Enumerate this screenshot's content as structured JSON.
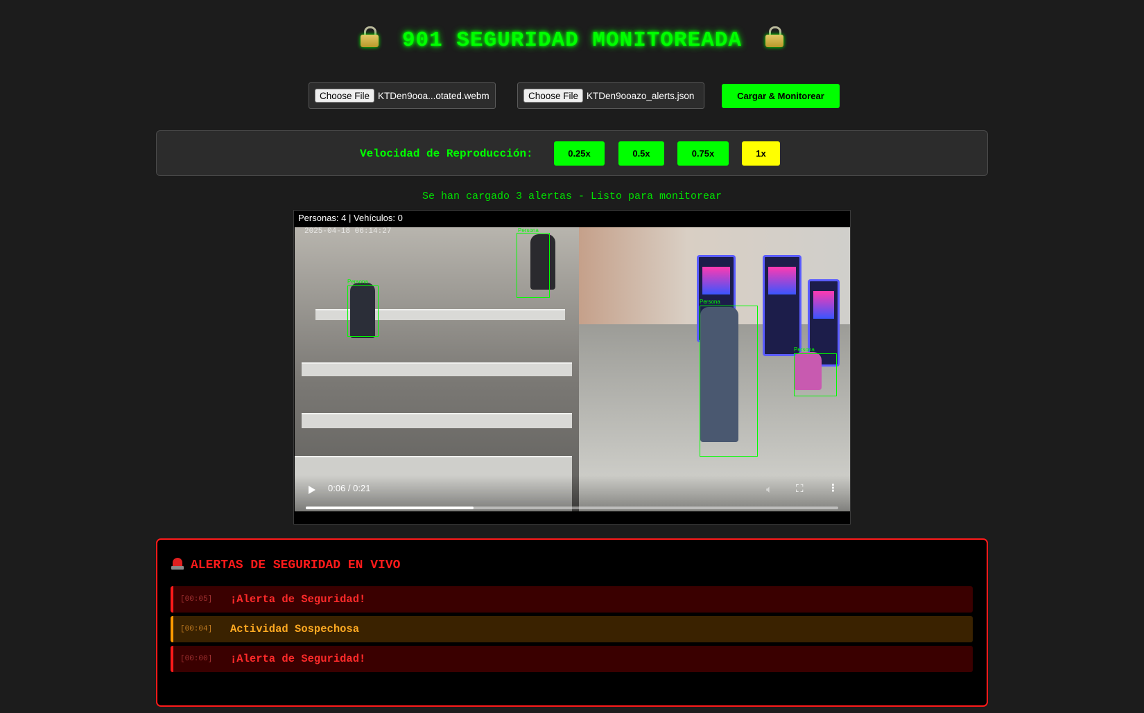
{
  "header": {
    "title": "901 SEGURIDAD MONITOREADA",
    "left_icon": "lock-icon",
    "right_icon": "lock-icon"
  },
  "uploads": {
    "video": {
      "button_label": "Choose File",
      "filename": "KTDen9ooa...otated.webm"
    },
    "alerts": {
      "button_label": "Choose File",
      "filename": "KTDen9ooazo_alerts.json"
    },
    "submit_label": "Cargar & Monitorear"
  },
  "speed": {
    "label": "Velocidad de Reproducción:",
    "options": [
      "0.25x",
      "0.5x",
      "0.75x",
      "1x"
    ],
    "selected": "1x"
  },
  "status_text": "Se han cargado 3 alertas - Listo para monitorear",
  "video": {
    "counter_text": "Personas: 4 | Vehículos: 0",
    "timestamp": "2025-04-18 06:14:27",
    "detection_label": "Persona",
    "time_display": "0:06 / 0:21",
    "progress_fraction": 0.315,
    "icons": [
      "play-icon",
      "volume-icon",
      "fullscreen-icon",
      "more-options-icon"
    ]
  },
  "alerts_panel": {
    "title": "ALERTAS DE SEGURIDAD EN VIVO",
    "icon": "siren-icon",
    "items": [
      {
        "time": "[00:05]",
        "message": "¡Alerta de Seguridad!",
        "level": "red"
      },
      {
        "time": "[00:04]",
        "message": "Actividad Sospechosa",
        "level": "orange"
      },
      {
        "time": "[00:00]",
        "message": "¡Alerta de Seguridad!",
        "level": "red"
      }
    ]
  },
  "colors": {
    "accent": "#00ff00",
    "selected": "#ffff00",
    "alert": "#ff1a1a",
    "warning": "#ff9900",
    "background": "#1c1c1c"
  }
}
